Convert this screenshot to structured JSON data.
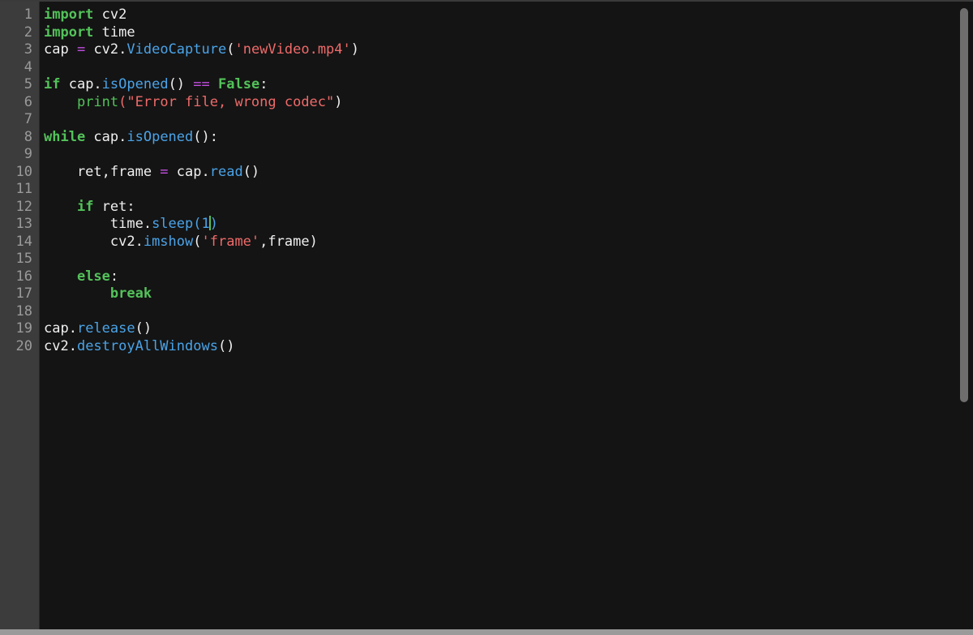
{
  "editor": {
    "line_numbers": [
      "1",
      "2",
      "3",
      "4",
      "5",
      "6",
      "7",
      "8",
      "9",
      "10",
      "11",
      "12",
      "13",
      "14",
      "15",
      "16",
      "17",
      "18",
      "19",
      "20"
    ],
    "tokens": {
      "l1_import": "import",
      "l1_rest": " cv2",
      "l2_import": "import",
      "l2_rest": " time",
      "l3_cap": "cap ",
      "l3_eq": "=",
      "l3_cv2": " cv2.",
      "l3_fn": "VideoCapture",
      "l3_open": "(",
      "l3_str": "'newVideo.mp4'",
      "l3_close": ")",
      "l5_if": "if",
      "l5_cap": " cap.",
      "l5_fn": "isOpened",
      "l5_paren": "() ",
      "l5_eqeq": "==",
      "l5_sp": " ",
      "l5_false": "False",
      "l5_colon": ":",
      "l6_indent": "    ",
      "l6_print": "print",
      "l6_open": "(",
      "l6_str": "\"Error file, wrong codec\"",
      "l6_close": ")",
      "l8_while": "while",
      "l8_cap": " cap.",
      "l8_fn": "isOpened",
      "l8_rest": "():",
      "l10_a": "    ret,frame ",
      "l10_eq": "=",
      "l10_b": " cap.",
      "l10_fn": "read",
      "l10_rest": "()",
      "l12_indent": "    ",
      "l12_if": "if",
      "l12_rest": " ret:",
      "l13_a": "        time.",
      "l13_fn": "sleep",
      "l13_open": "(",
      "l13_num": "1",
      "l13_close": ")",
      "l14_a": "        cv2.",
      "l14_fn": "imshow",
      "l14_open": "(",
      "l14_str": "'frame'",
      "l14_rest": ",frame)",
      "l16_indent": "    ",
      "l16_else": "else",
      "l16_colon": ":",
      "l17_indent": "        ",
      "l17_break": "break",
      "l19_a": "cap.",
      "l19_fn": "release",
      "l19_rest": "()",
      "l20_a": "cv2.",
      "l20_fn": "destroyAllWindows",
      "l20_rest": "()"
    }
  },
  "colors": {
    "background": "#141414",
    "gutter": "#3c3c3c",
    "keyword": "#53c25a",
    "function": "#4aa3e8",
    "string": "#ef6a6a",
    "operator": "#c24fe0",
    "text": "#f0f0f0",
    "line_number": "#9a9a9a"
  }
}
